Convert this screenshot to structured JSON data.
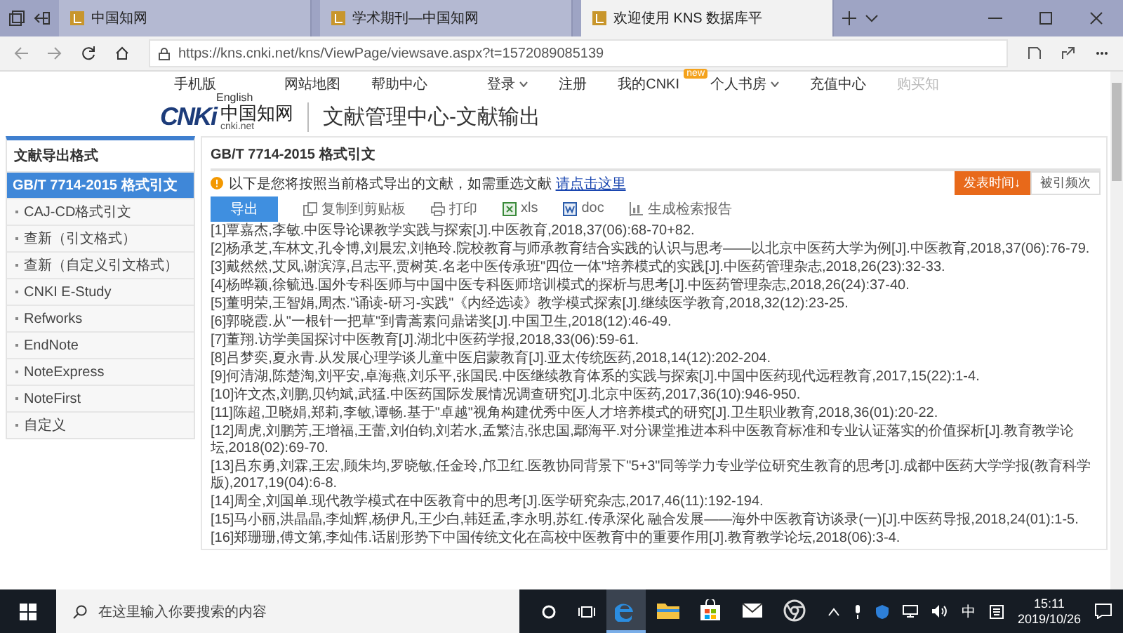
{
  "browser": {
    "tabs": [
      {
        "title": "中国知网",
        "selected": false
      },
      {
        "title": "学术期刊—中国知网",
        "selected": false
      },
      {
        "title": "欢迎使用 KNS 数据库平",
        "selected": true
      }
    ],
    "url": "https://kns.cnki.net/kns/ViewPage/viewsave.aspx?t=1572089085139"
  },
  "site_header": {
    "links_left": [
      "手机版",
      "网站地图",
      "帮助中心"
    ],
    "language": "English",
    "links_right": [
      {
        "label": "登录",
        "has_caret": true
      },
      {
        "label": "注册",
        "has_caret": false
      },
      {
        "label": "我的CNKI",
        "has_caret": false,
        "badge": "new"
      },
      {
        "label": "个人书房",
        "has_caret": true
      },
      {
        "label": "充值中心",
        "has_caret": false
      },
      {
        "label": "购买知",
        "has_caret": false
      }
    ]
  },
  "logo": {
    "mark": "CNKi",
    "name": "中国知网",
    "domain": "cnki.net"
  },
  "page_title": "文献管理中心-文献输出",
  "sidebar": {
    "title": "文献导出格式",
    "items": [
      {
        "label": "GB/T 7714-2015 格式引文",
        "selected": true
      },
      {
        "label": "CAJ-CD格式引文",
        "selected": false
      },
      {
        "label": "查新（引文格式）",
        "selected": false
      },
      {
        "label": "查新（自定义引文格式）",
        "selected": false
      },
      {
        "label": "CNKI E-Study",
        "selected": false
      },
      {
        "label": "Refworks",
        "selected": false
      },
      {
        "label": "EndNote",
        "selected": false
      },
      {
        "label": "NoteExpress",
        "selected": false
      },
      {
        "label": "NoteFirst",
        "selected": false
      },
      {
        "label": "自定义",
        "selected": false
      }
    ]
  },
  "main": {
    "title": "GB/T 7714-2015 格式引文",
    "notice": {
      "text": "以下是您将按照当前格式导出的文献，如需重选文献",
      "link": "请点击这里"
    },
    "sort_buttons": [
      {
        "label": "发表时间↓",
        "selected": true
      },
      {
        "label": "被引频次",
        "selected": false
      }
    ],
    "export_button": "导出",
    "actions": [
      {
        "kind": "copy",
        "label": "复制到剪贴板"
      },
      {
        "kind": "print",
        "label": "打印"
      },
      {
        "kind": "xls",
        "label": "xls"
      },
      {
        "kind": "doc",
        "label": "doc"
      },
      {
        "kind": "report",
        "label": "生成检索报告"
      }
    ],
    "references": [
      "[1]覃嘉杰,李敏.中医导论课教学实践与探索[J].中医教育,2018,37(06):68-70+82.",
      "[2]杨承芝,车林文,孔令博,刘晨宏,刘艳玲.院校教育与师承教育结合实践的认识与思考——以北京中医药大学为例[J].中医教育,2018,37(06):76-79.",
      "[3]戴然然,艾凤,谢滨淳,吕志平,贾树英.名老中医传承班\"四位一体\"培养模式的实践[J].中医药管理杂志,2018,26(23):32-33.",
      "[4]杨晔颖,徐毓迅.国外专科医师与中国中医专科医师培训模式的探析与思考[J].中医药管理杂志,2018,26(24):37-40.",
      "[5]董明荣,王智娟,周杰.\"诵读-研习-实践\"《内经选读》教学模式探索[J].继续医学教育,2018,32(12):23-25.",
      "[6]郭晓霞.从\"一根针一把草\"到青蒿素问鼎诺奖[J].中国卫生,2018(12):46-49.",
      "[7]董翔.访学美国探讨中医教育[J].湖北中医药学报,2018,33(06):59-61.",
      "[8]吕梦奕,夏永青.从发展心理学谈儿童中医启蒙教育[J].亚太传统医药,2018,14(12):202-204.",
      "[9]何清湖,陈楚淘,刘平安,卓海燕,刘乐平,张国民.中医继续教育体系的实践与探索[J].中国中医药现代远程教育,2017,15(22):1-4.",
      "[10]许文杰,刘鹏,贝钧斌,武猛.中医药国际发展情况调查研究[J].北京中医药,2017,36(10):946-950.",
      "[11]陈超,卫晓娟,郑莉,李敏,谭畅.基于\"卓越\"视角构建优秀中医人才培养模式的研究[J].卫生职业教育,2018,36(01):20-22.",
      "[12]周虎,刘鹏芳,王增福,王蕾,刘伯钧,刘若水,孟繁洁,张忠国,鄢海平.对分课堂推进本科中医教育标准和专业认证落实的价值探析[J].教育教学论坛,2018(02):69-70.",
      "[13]吕东勇,刘霖,王宏,顾朱均,罗晓敏,任金玲,邝卫红.医教协同背景下\"5+3\"同等学力专业学位研究生教育的思考[J].成都中医药大学学报(教育科学版),2017,19(04):6-8.",
      "[14]周全,刘国单.现代教学模式在中医教育中的思考[J].医学研究杂志,2017,46(11):192-194.",
      "[15]马小丽,洪晶晶,李灿辉,杨伊凡,王少白,韩廷孟,李永明,苏红.传承深化 融合发展——海外中医教育访谈录(一)[J].中医药导报,2018,24(01):1-5.",
      "[16]郑珊珊,傅文第,李灿伟.话剧形势下中国传统文化在高校中医教育中的重要作用[J].教育教学论坛,2018(06):3-4."
    ]
  },
  "taskbar": {
    "search_placeholder": "在这里输入你要搜索的内容",
    "apps": [
      {
        "kind": "edge",
        "active": true
      },
      {
        "kind": "folder",
        "active": false
      },
      {
        "kind": "store",
        "active": false
      },
      {
        "kind": "mail",
        "active": false
      },
      {
        "kind": "chrome",
        "active": false
      }
    ],
    "ime": "中",
    "time": "15:11",
    "date": "2019/10/26"
  }
}
